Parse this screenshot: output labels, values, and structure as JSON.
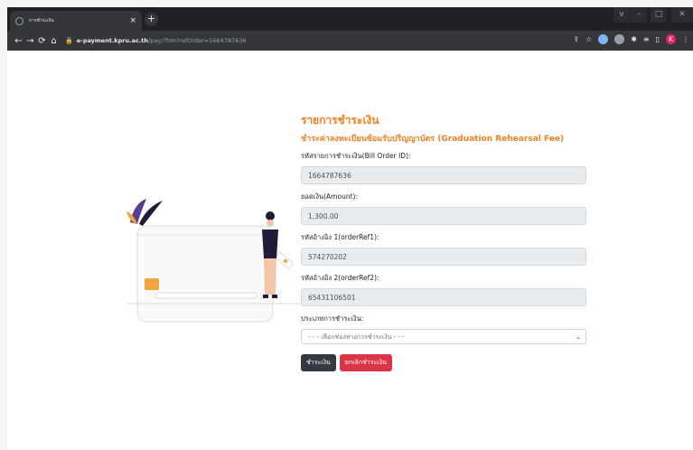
{
  "browser": {
    "tab_title": "การชำระเงิน",
    "tab_close": "×",
    "new_tab": "+",
    "url_host": "e-payment.kpru.ac.th",
    "url_path": "/pay/?frm?refOrder=1664787636",
    "profile_initial": "K",
    "win_controls": [
      "v",
      "–",
      "□",
      "✕"
    ]
  },
  "form": {
    "title": "รายการชำระเงิน",
    "subtitle": "ชำระค่าลงทะเบียนซ้อมรับปริญญาบัตร (Graduation Rehearsal Fee)",
    "bill_order_label": "รหัสรายการชำระเงิน(Bill Order ID):",
    "bill_order_value": "1664787636",
    "amount_label": "ยอดเงิน(Amount):",
    "amount_value": "1,300.00",
    "ref1_label": "รหัสอ้างอิง 1(orderRef1):",
    "ref1_value": "574270202",
    "ref2_label": "รหัสอ้างอิง 2(orderRef2):",
    "ref2_value": "65431106501",
    "pay_type_label": "ประเภทการชำระเงิน:",
    "pay_type_selected": "- - - เลือกช่องทางการชำระเงิน - - -",
    "pay_button": "ชำระเงิน",
    "cancel_button": "ยกเลิกชำระเงิน"
  },
  "colors": {
    "accent": "#f07f21",
    "pay_button": "#343a40",
    "cancel_button": "#dc3545"
  }
}
